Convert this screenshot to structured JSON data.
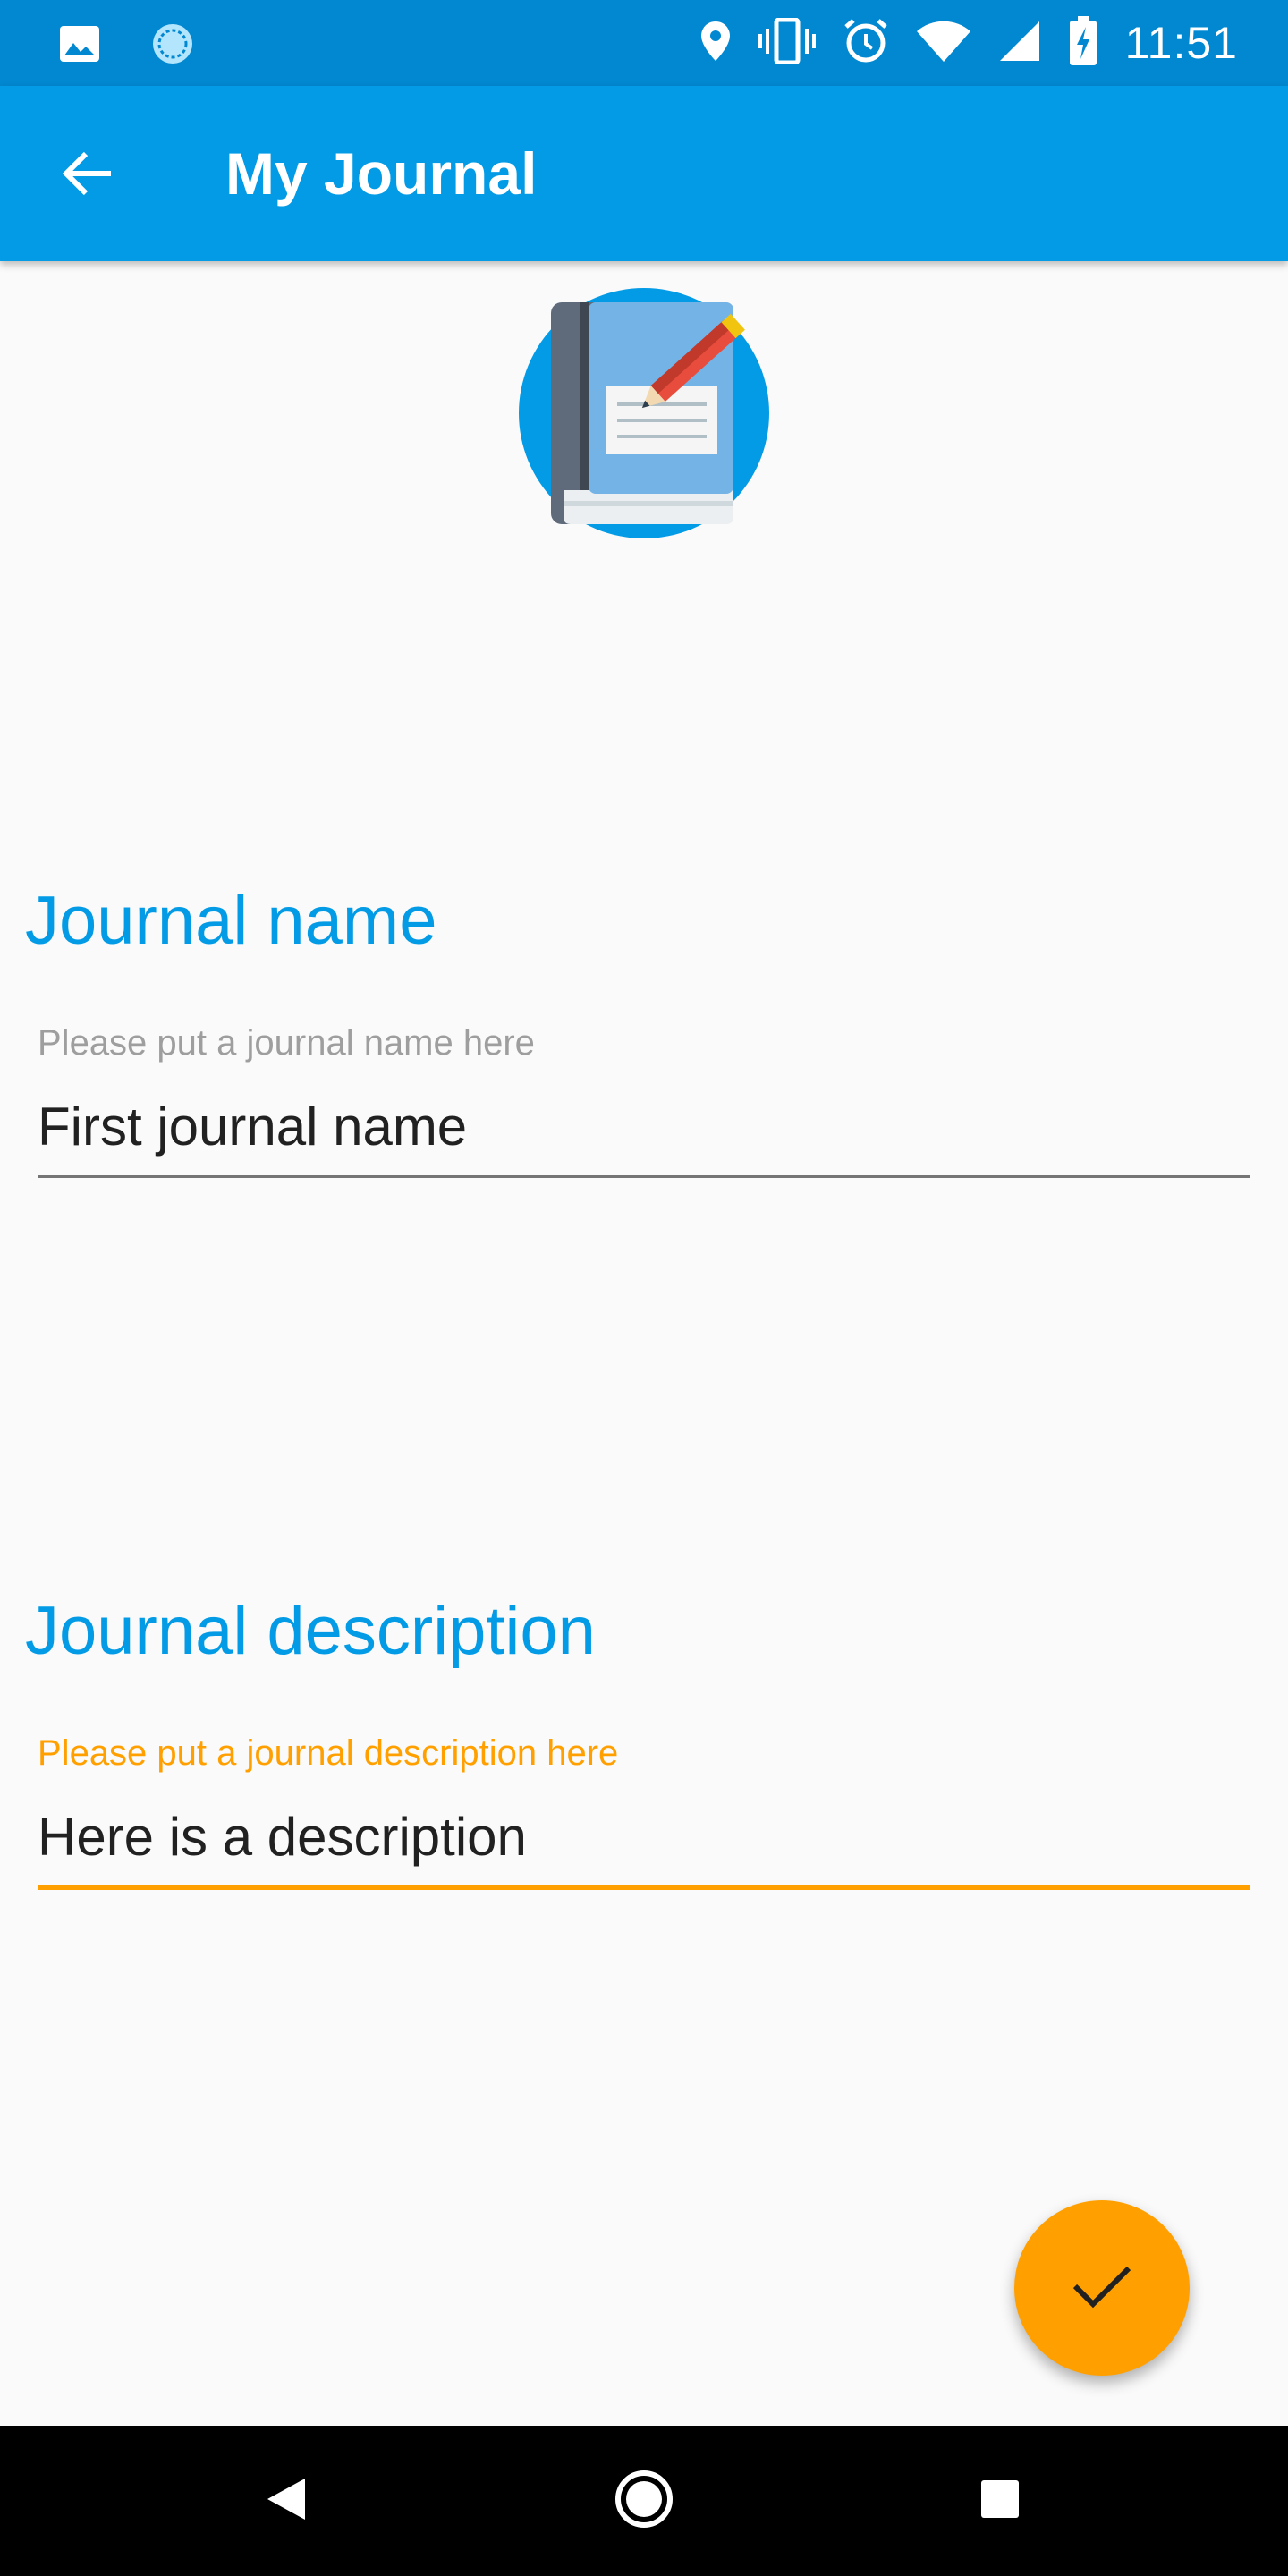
{
  "status_bar": {
    "time": "11:51",
    "icons_left": [
      "image-icon",
      "sync-icon"
    ],
    "icons_right": [
      "location-icon",
      "vibrate-icon",
      "alarm-icon",
      "wifi-icon",
      "signal-icon",
      "battery-charging-icon"
    ]
  },
  "app_bar": {
    "title": "My Journal",
    "back_icon": "arrow-back-icon"
  },
  "logo": {
    "icon": "journal-book-icon"
  },
  "name_section": {
    "title": "Journal name",
    "label": "Please put a journal name here",
    "value": "First journal name"
  },
  "description_section": {
    "title": "Journal description",
    "label": "Please put a journal description here",
    "value": "Here is a description"
  },
  "fab": {
    "icon": "check-icon"
  },
  "nav_bar": {
    "icons": [
      "back-triangle-icon",
      "home-circle-icon",
      "recents-square-icon"
    ]
  },
  "colors": {
    "status_bar": "#0288d1",
    "app_bar": "#039be5",
    "accent": "#ffa000",
    "section_title": "#039be5",
    "background": "#fafafa"
  }
}
